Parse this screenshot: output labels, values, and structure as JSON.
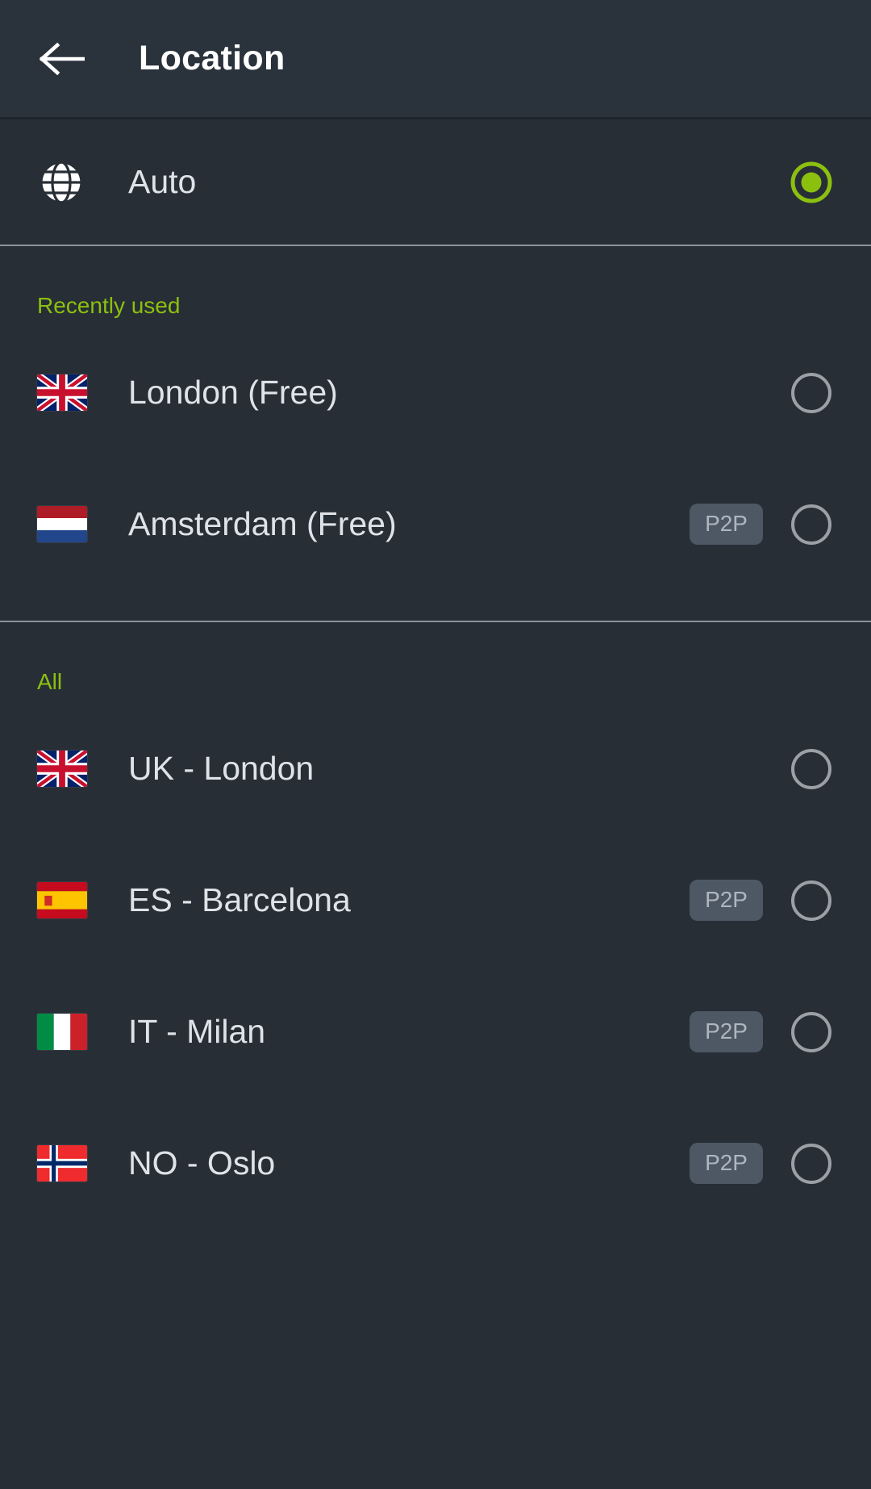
{
  "header": {
    "title": "Location",
    "back_icon": "arrow-left-icon"
  },
  "colors": {
    "background": "#272e36",
    "appbar_background": "#2a323b",
    "accent_green": "#8cc00f",
    "text_primary": "#dfe3e8",
    "text_title": "#ffffff",
    "radio_unselected": "#9aa0a6",
    "badge_background": "#4d5864",
    "badge_text": "#aeb6bf",
    "divider": "#8c939b"
  },
  "auto": {
    "icon": "globe-icon",
    "label": "Auto",
    "selected": true
  },
  "sections": [
    {
      "title": "Recently used",
      "items": [
        {
          "label": "London (Free)",
          "flag": "flag-uk",
          "badge": "",
          "selected": false
        },
        {
          "label": "Amsterdam (Free)",
          "flag": "flag-netherlands",
          "badge": "P2P",
          "selected": false
        }
      ]
    },
    {
      "title": "All",
      "items": [
        {
          "label": "UK - London",
          "flag": "flag-uk",
          "badge": "",
          "selected": false
        },
        {
          "label": "ES - Barcelona",
          "flag": "flag-spain",
          "badge": "P2P",
          "selected": false
        },
        {
          "label": "IT - Milan",
          "flag": "flag-italy",
          "badge": "P2P",
          "selected": false
        },
        {
          "label": "NO - Oslo",
          "flag": "flag-norway",
          "badge": "P2P",
          "selected": false
        }
      ]
    }
  ]
}
